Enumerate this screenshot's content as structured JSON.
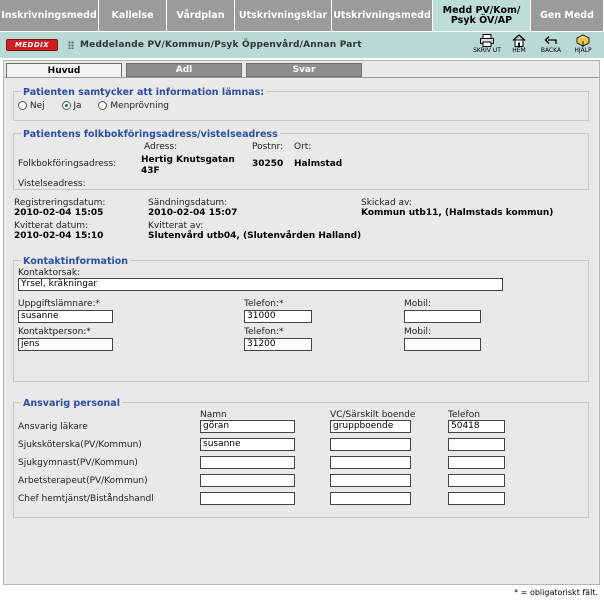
{
  "topnav": {
    "tabs": [
      {
        "label": "Inskrivningsmedd",
        "width": 99
      },
      {
        "label": "Kallelse",
        "width": 68
      },
      {
        "label": "Vårdplan",
        "width": 68
      },
      {
        "label": "Utskrivningsklar",
        "width": 97
      },
      {
        "label": "Utskrivningsmedd",
        "width": 101
      },
      {
        "label": "Medd PV/Kom/\nPsyk ÖV/AP",
        "width": 98,
        "active": true
      },
      {
        "label": "Gen Medd",
        "width": 73
      }
    ]
  },
  "header": {
    "logo_text": "MEDDIX",
    "title": "Meddelande PV/Kommun/Psyk Öppenvård/Annan Part",
    "tools": {
      "print": "SKRIV UT",
      "home": "HEM",
      "back": "BACKA",
      "help": "HJÄLP"
    }
  },
  "subtabs": {
    "main": "Huvud",
    "adl": "Adl",
    "answer": "Svar"
  },
  "consent": {
    "title": "Patienten samtycker att information lämnas:",
    "options": {
      "no": "Nej",
      "yes": "Ja",
      "trial": "Menprövning"
    },
    "selected": "yes"
  },
  "address": {
    "title": "Patientens folkbokföringsadress/vistelseadress",
    "col_address": "Adress:",
    "col_zip": "Postnr:",
    "col_city": "Ort:",
    "folk_label": "Folkbokföringsadress:",
    "folk_street": "Hertig Knutsgatan 43F",
    "folk_zip": "30250",
    "folk_city": "Halmstad",
    "vist_label": "Vistelseadress:"
  },
  "meta": {
    "reg_label": "Registreringsdatum:",
    "reg_value": "2010-02-04 15:05",
    "sent_label": "Sändningsdatum:",
    "sent_value": "2010-02-04 15:07",
    "sentby_label": "Skickad av:",
    "sentby_value": "Kommun utb11, (Halmstads kommun)",
    "ack_label": "Kvitterat datum:",
    "ack_value": "2010-02-04 15:10",
    "ackby_label": "Kvitterat av:",
    "ackby_value": "Slutenvård utb04, (Slutenvården Halland)"
  },
  "contact": {
    "title": "Kontaktinformation",
    "reason_label": "Kontaktorsak:",
    "reason_value": "Yrsel, kräkningar",
    "informant_label": "Uppgiftslämnare:*",
    "informant_value": "susanne",
    "phone1_label": "Telefon:*",
    "phone1_value": "31000",
    "mobile1_label": "Mobil:",
    "mobile1_value": "",
    "person_label": "Kontaktperson:*",
    "person_value": "jens",
    "phone2_label": "Telefon:*",
    "phone2_value": "31200",
    "mobile2_label": "Mobil:",
    "mobile2_value": ""
  },
  "staff": {
    "title": "Ansvarig personal",
    "col_name": "Namn",
    "col_housing": "VC/Särskilt boende",
    "col_phone": "Telefon",
    "rows": [
      {
        "role": "Ansvarig läkare",
        "name": "göran",
        "housing": "gruppboende",
        "phone": "50418"
      },
      {
        "role": "Sjuksköterska(PV/Kommun)",
        "name": "susanne",
        "housing": "",
        "phone": ""
      },
      {
        "role": "Sjukgymnast(PV/Kommun)",
        "name": "",
        "housing": "",
        "phone": ""
      },
      {
        "role": "Arbetsterapeut(PV/Kommun)",
        "name": "",
        "housing": "",
        "phone": ""
      },
      {
        "role": "Chef hemtjänst/Biståndshandl",
        "name": "",
        "housing": "",
        "phone": ""
      }
    ]
  },
  "footnote": "* = obligatoriskt fält.",
  "colors": {
    "tab_gray": "#9b9b9b",
    "tab_active": "#bdddd9",
    "header_teal": "#b8d9d4",
    "section_blue": "#2a4fa6",
    "logo_red": "#cc1f1f"
  }
}
